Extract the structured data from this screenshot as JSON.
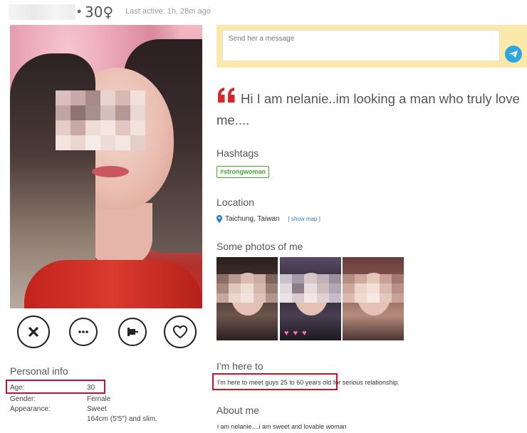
{
  "header": {
    "age": "30",
    "gender_symbol": "♀",
    "separator": "•",
    "last_active": "Last active: 1h, 28m ago"
  },
  "message": {
    "placeholder": "Send her a message"
  },
  "quote": {
    "text": "Hi I am nelanie..im looking a man who truly love me...."
  },
  "hashtags": {
    "title": "Hashtags",
    "items": [
      "#strongwoman"
    ]
  },
  "location": {
    "title": "Location",
    "place": "Taichung, Taiwan",
    "show_map": "[ show map ]"
  },
  "photos": {
    "title": "Some photos of me"
  },
  "here_to": {
    "title": "I'm here to",
    "text": "I'm here to meet guys 25 to 60 years old for serious relationship."
  },
  "about": {
    "title": "About me",
    "text": "i am nelanie....i am sweet and lovable woman"
  },
  "personal_info": {
    "title": "Personal info",
    "rows": [
      {
        "label": "Age:",
        "value": "30"
      },
      {
        "label": "Gender:",
        "value": "Female"
      },
      {
        "label": "Appearance:",
        "value": "Sweet"
      }
    ],
    "appearance_detail": "164cm (5'5\") and slim."
  },
  "colors": {
    "accent_red": "#d3292d",
    "highlight_box": "#c8102e",
    "message_bg": "#fbe9ab",
    "send_button": "#2ea7e0",
    "hashtag_green": "#49a536",
    "link_blue": "#2a7ac9"
  },
  "icons": {
    "reject": "close-x-icon",
    "more": "more-dots-icon",
    "pin": "pin-icon",
    "like": "heart-icon",
    "send": "paper-plane-icon",
    "quote": "quote-icon",
    "location": "location-pin-icon"
  }
}
